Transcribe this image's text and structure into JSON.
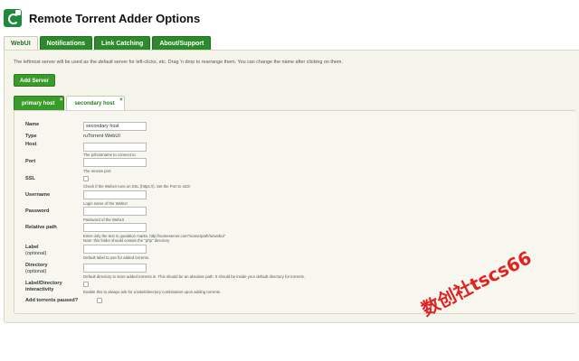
{
  "app": {
    "title": "Remote Torrent Adder Options",
    "logo_icon": "torrent-adder-logo-icon"
  },
  "tabs": [
    {
      "label": "WebUI",
      "active": true
    },
    {
      "label": "Notifications",
      "active": false
    },
    {
      "label": "Link Catching",
      "active": false
    },
    {
      "label": "About/Support",
      "active": false
    }
  ],
  "webui": {
    "intro_before": "The leftmost server will be used as the ",
    "intro_em": "default",
    "intro_after": " server for left-clicks, etc. Drag 'n drop to rearrange them. You can change the name after clicking on them.",
    "add_server_label": "Add Server",
    "servers": [
      {
        "label": "primary host",
        "close": "×"
      },
      {
        "label": "secondary host",
        "close": "×"
      }
    ]
  },
  "form": {
    "name": {
      "label": "Name",
      "value": "secondary host"
    },
    "type": {
      "label": "Type",
      "value": "ruTorrent WebUI"
    },
    "host": {
      "label": "Host",
      "value": "",
      "hint": "The ip/hostname to connect to"
    },
    "port": {
      "label": "Port",
      "value": "",
      "hint": "The remote port"
    },
    "ssl": {
      "label": "SSL",
      "checked": false,
      "hint": "Check if the WebUI runs on SSL (https://). Set the Port to 443!"
    },
    "username": {
      "label": "Username",
      "value": "",
      "hint": "Login name of the WebUI"
    },
    "password": {
      "label": "Password",
      "value": "",
      "hint": "Password of the WebUI"
    },
    "relative_path": {
      "label": "Relative path",
      "value": "",
      "hint1": "Enter only the text in quotation marks. http://someserver.com\"/some/path/to/webui\"",
      "hint2": "Note: this folder should contain the \"php\" directory"
    },
    "label_opt": {
      "label": "Label",
      "sub": "(optional)",
      "value": "",
      "hint": "Default label to use for added torrents."
    },
    "directory_opt": {
      "label": "Directory",
      "sub": "(optional)",
      "value": "",
      "hint": "Default directory to store added torrents in. This should be an absolute path. It should be inside your default directory for torrents."
    },
    "label_dir": {
      "label": "Label/Directory",
      "sub": "interactivity",
      "checked": false,
      "hint": "Enable this to always ask for a label/directory combination upon adding torrents."
    },
    "paused": {
      "label": "Add torrents paused?",
      "checked": false
    }
  },
  "watermark": "数创社tscs66",
  "colors": {
    "accent": "#3a9a2a",
    "tab_green": "#2b8a2b",
    "panel_bg": "#f4f4ea",
    "watermark": "#e01010"
  }
}
